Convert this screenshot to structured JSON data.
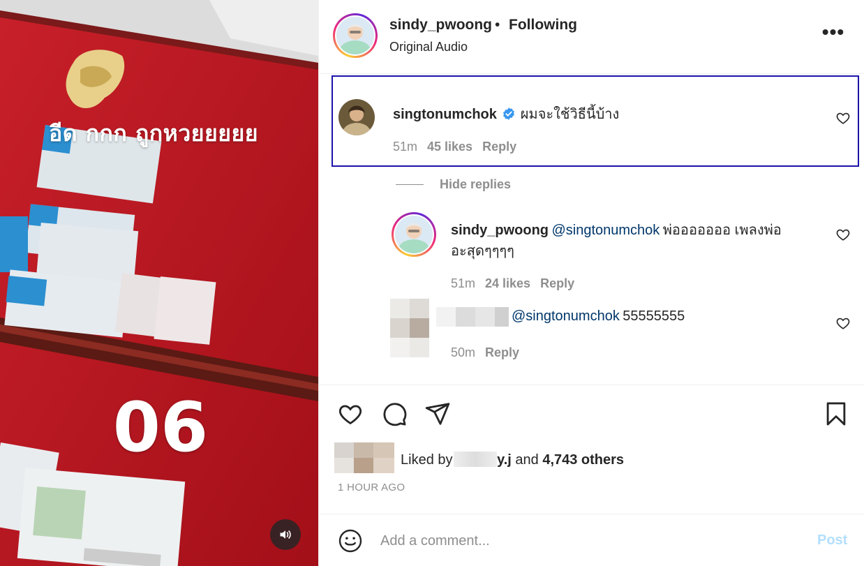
{
  "media": {
    "caption": "อีด  กกก ถูกหวยยยยย",
    "number": "06",
    "sound_icon": "speaker-icon"
  },
  "header": {
    "username": "sindy_pwoong",
    "separator": "•",
    "follow_label": "Following",
    "audio": "Original Audio",
    "more_icon": "more-icon",
    "more_label": "•••"
  },
  "comments": [
    {
      "username": "singtonumchok",
      "verified": true,
      "text": "ผมจะใช้วิธีนี้บ้าง",
      "time": "51m",
      "likes": "45 likes",
      "reply": "Reply"
    }
  ],
  "hide_replies": "Hide replies",
  "replies": [
    {
      "username": "sindy_pwoong",
      "mention": "@singtonumchok",
      "text_line1": "พ่อออออออ เพลงพ่อ",
      "text_line2": "อะสุดๆๆๆๆ",
      "time": "51m",
      "likes": "24 likes",
      "reply": "Reply"
    },
    {
      "username": "",
      "mention": "@singtonumchok",
      "text": "55555555",
      "time": "50m",
      "reply": "Reply"
    }
  ],
  "actions": {
    "like_icon": "heart-icon",
    "comment_icon": "comment-icon",
    "share_icon": "share-icon",
    "save_icon": "bookmark-icon"
  },
  "likes": {
    "prefix": "Liked by",
    "user_suffix": "y.j",
    "and": "and",
    "others": "4,743 others"
  },
  "timestamp": "1 HOUR AGO",
  "add_comment": {
    "placeholder": "Add a comment...",
    "post_label": "Post",
    "emoji_icon": "emoji-icon"
  },
  "colors": {
    "highlight_border": "#1b14a8",
    "mention": "#00376b",
    "post_disabled": "#b2dffc",
    "verified": "#3897f0"
  }
}
